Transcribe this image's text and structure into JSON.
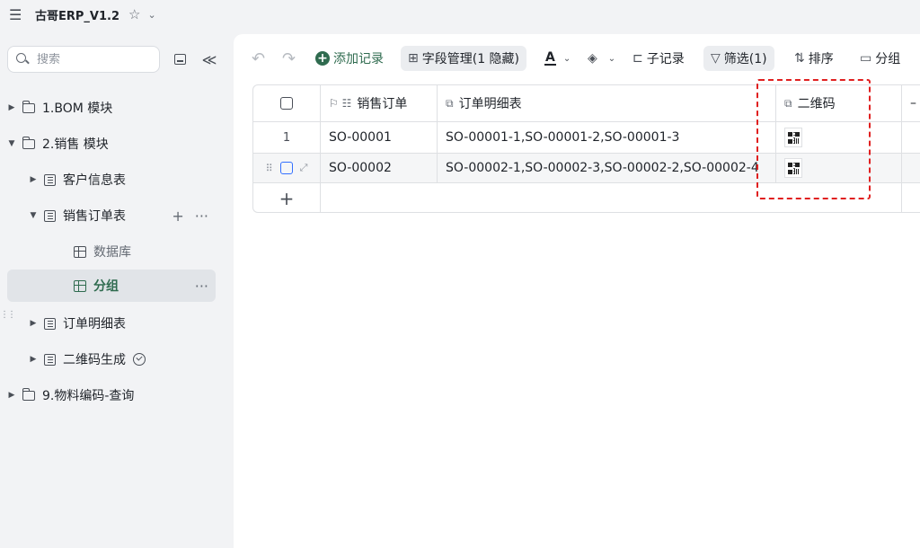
{
  "topbar": {
    "menu_icon": "menu-icon",
    "title": "古哥ERP_V1.2",
    "star_icon": "star-icon",
    "caret_icon": "chevron-down-icon"
  },
  "sidebar": {
    "search_placeholder": "搜索",
    "collapse_glyph": "≪",
    "items": [
      {
        "label": "1.BOM 模块",
        "type": "folder",
        "expanded": false
      },
      {
        "label": "2.销售 模块",
        "type": "folder",
        "expanded": true
      },
      {
        "label": "客户信息表",
        "type": "table",
        "expanded": false
      },
      {
        "label": "销售订单表",
        "type": "table",
        "expanded": true
      },
      {
        "label": "数据库",
        "type": "view"
      },
      {
        "label": "分组",
        "type": "view",
        "active": true
      },
      {
        "label": "订单明细表",
        "type": "table",
        "expanded": false
      },
      {
        "label": "二维码生成",
        "type": "automation",
        "expanded": false
      },
      {
        "label": "9.物料编码-查询",
        "type": "folder",
        "expanded": false
      }
    ],
    "item_actions": {
      "add": "+",
      "more": "···"
    }
  },
  "toolbar": {
    "undo_glyph": "↶",
    "redo_glyph": "↷",
    "add_record": "添加记录",
    "field_manage": "字段管理(1 隐藏)",
    "font_glyph": "A",
    "fill_glyph": "◈",
    "sub_record": "子记录",
    "filter": "筛选(1)",
    "sort": "排序",
    "group": "分组",
    "accent": "#2f6b4f"
  },
  "table": {
    "columns": [
      "销售订单",
      "订单明细表",
      "二维码"
    ],
    "rows": [
      {
        "num": "1",
        "order": "SO-00001",
        "details": "SO-00001-1,SO-00001-2,SO-00001-3"
      },
      {
        "num": "",
        "order": "SO-00002",
        "details": "SO-00002-1,SO-00002-3,SO-00002-2,SO-00002-4"
      }
    ],
    "add_row_glyph": "+",
    "more_col_glyph": "–"
  },
  "highlight_color": "#e02020"
}
